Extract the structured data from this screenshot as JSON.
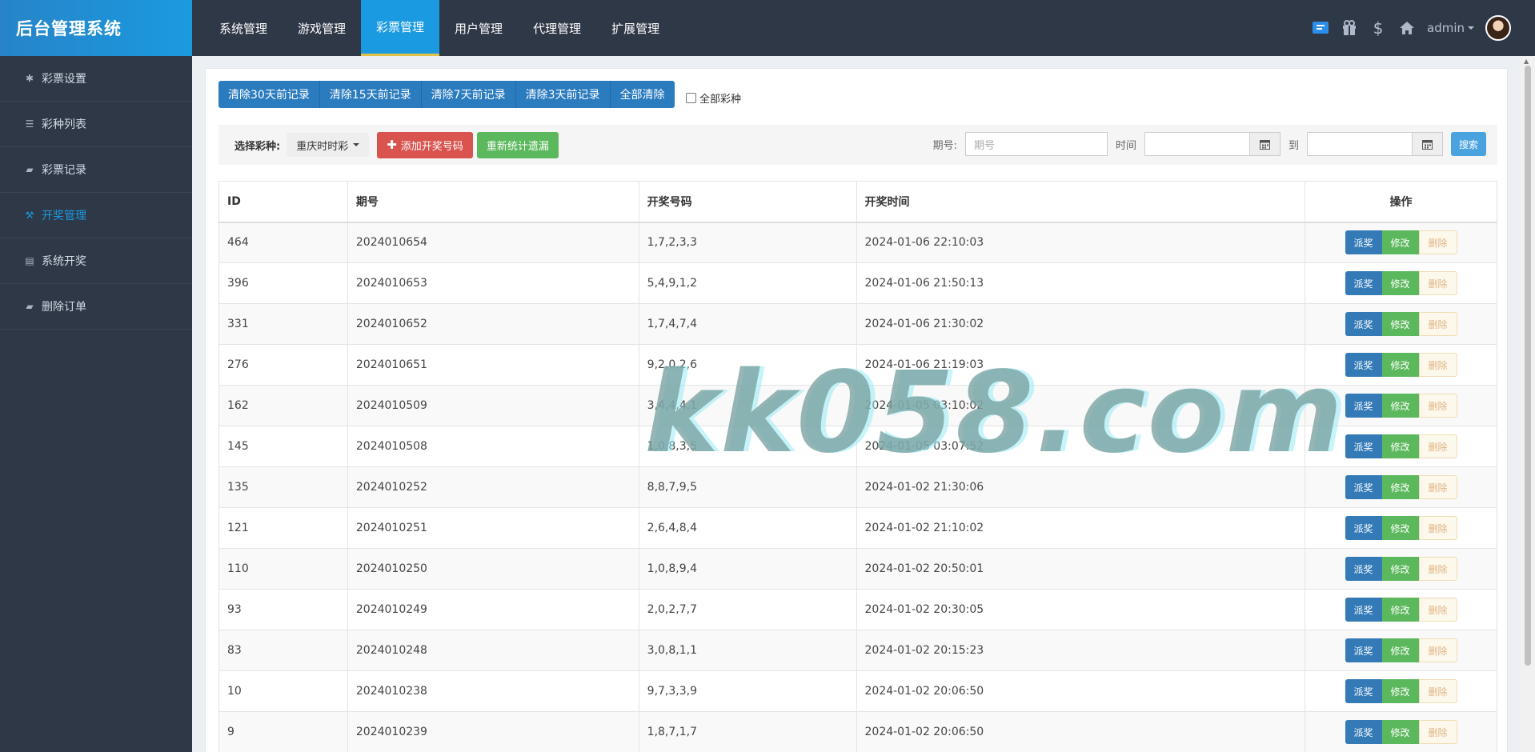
{
  "brand": "后台管理系统",
  "topnav": [
    "系统管理",
    "游戏管理",
    "彩票管理",
    "用户管理",
    "代理管理",
    "扩展管理"
  ],
  "user": {
    "name": "admin"
  },
  "sidebar": [
    {
      "label": "彩票设置",
      "icon": "gear-icon"
    },
    {
      "label": "彩种列表",
      "icon": "list-icon"
    },
    {
      "label": "彩票记录",
      "icon": "book-icon"
    },
    {
      "label": "开奖管理",
      "icon": "gavel-icon"
    },
    {
      "label": "系统开奖",
      "icon": "card-icon"
    },
    {
      "label": "删除订单",
      "icon": "book-icon"
    }
  ],
  "clear_buttons": [
    "清除30天前记录",
    "清除15天前记录",
    "清除7天前记录",
    "清除3天前记录",
    "全部清除"
  ],
  "all_types_label": "全部彩种",
  "filter": {
    "select_label": "选择彩种:",
    "selected_type": "重庆时时彩",
    "add_label": "添加开奖号码",
    "recount_label": "重新统计遗漏",
    "issue_label": "期号:",
    "issue_placeholder": "期号",
    "time_label": "时间",
    "to_label": "到",
    "search_label": "搜索"
  },
  "table": {
    "headers": [
      "ID",
      "期号",
      "开奖号码",
      "开奖时间",
      "操作"
    ],
    "actions": [
      "派奖",
      "修改",
      "删除"
    ],
    "rows": [
      [
        "464",
        "2024010654",
        "1,7,2,3,3",
        "2024-01-06 22:10:03"
      ],
      [
        "396",
        "2024010653",
        "5,4,9,1,2",
        "2024-01-06 21:50:13"
      ],
      [
        "331",
        "2024010652",
        "1,7,4,7,4",
        "2024-01-06 21:30:02"
      ],
      [
        "276",
        "2024010651",
        "9,2,0,2,6",
        "2024-01-06 21:19:03"
      ],
      [
        "162",
        "2024010509",
        "3,4,4,4,1",
        "2024-01-05 03:10:02"
      ],
      [
        "145",
        "2024010508",
        "1,0,8,3,5",
        "2024-01-05 03:07:52"
      ],
      [
        "135",
        "2024010252",
        "8,8,7,9,5",
        "2024-01-02 21:30:06"
      ],
      [
        "121",
        "2024010251",
        "2,6,4,8,4",
        "2024-01-02 21:10:02"
      ],
      [
        "110",
        "2024010250",
        "1,0,8,9,4",
        "2024-01-02 20:50:01"
      ],
      [
        "93",
        "2024010249",
        "2,0,2,7,7",
        "2024-01-02 20:30:05"
      ],
      [
        "83",
        "2024010248",
        "3,0,8,1,1",
        "2024-01-02 20:15:23"
      ],
      [
        "10",
        "2024010238",
        "9,7,3,3,9",
        "2024-01-02 20:06:50"
      ],
      [
        "9",
        "2024010239",
        "1,8,7,1,7",
        "2024-01-02 20:06:50"
      ]
    ]
  },
  "watermark": "kk058.com",
  "colors": {
    "topbar": "#2f3847",
    "accent": "#1a9ae0",
    "primary": "#337ab7",
    "success": "#5cb85c",
    "danger": "#d9534f"
  }
}
